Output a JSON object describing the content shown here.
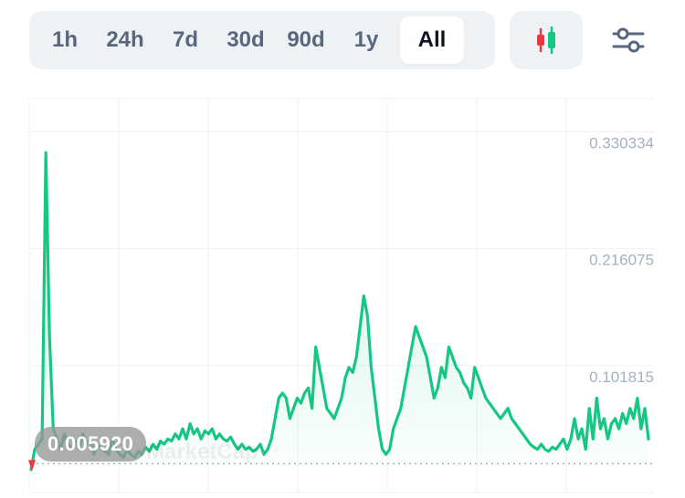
{
  "toolbar": {
    "ranges": [
      "1h",
      "24h",
      "7d",
      "30d",
      "90d",
      "1y",
      "All"
    ],
    "active_range": "All",
    "candle_icon": "candlestick-icon",
    "settings_icon": "sliders-icon"
  },
  "current_price_label": "0.005920",
  "watermark": "MarketCap",
  "colors": {
    "line": "#16c784",
    "fill": "#16c784",
    "baseline_marker": "#ea3943",
    "grid": "#eff2f5",
    "axis_text": "#a6b0c3"
  },
  "chart_data": {
    "type": "area",
    "y_ticks": [
      "0.330334",
      "0.216075",
      "0.101815"
    ],
    "y_tick_values": [
      0.330334,
      0.216075,
      0.101815
    ],
    "ylim": [
      0.0,
      0.345
    ],
    "current_value": 0.00592,
    "grid": true,
    "series": [
      {
        "values": [
          0.0,
          0.02,
          0.025,
          0.03,
          0.31,
          0.13,
          0.04,
          0.03,
          0.02,
          0.035,
          0.025,
          0.02,
          0.028,
          0.02,
          0.035,
          0.025,
          0.03,
          0.015,
          0.025,
          0.02,
          0.018,
          0.015,
          0.03,
          0.02,
          0.015,
          0.012,
          0.02,
          0.015,
          0.012,
          0.018,
          0.015,
          0.022,
          0.018,
          0.025,
          0.02,
          0.028,
          0.025,
          0.03,
          0.028,
          0.035,
          0.03,
          0.04,
          0.03,
          0.045,
          0.035,
          0.04,
          0.03,
          0.038,
          0.035,
          0.04,
          0.03,
          0.035,
          0.03,
          0.028,
          0.032,
          0.025,
          0.02,
          0.025,
          0.02,
          0.022,
          0.018,
          0.02,
          0.025,
          0.015,
          0.02,
          0.03,
          0.05,
          0.07,
          0.075,
          0.07,
          0.05,
          0.06,
          0.07,
          0.065,
          0.075,
          0.08,
          0.06,
          0.12,
          0.1,
          0.08,
          0.06,
          0.055,
          0.05,
          0.06,
          0.07,
          0.09,
          0.1,
          0.095,
          0.11,
          0.14,
          0.17,
          0.15,
          0.1,
          0.07,
          0.04,
          0.02,
          0.015,
          0.02,
          0.04,
          0.05,
          0.06,
          0.08,
          0.1,
          0.12,
          0.14,
          0.13,
          0.12,
          0.11,
          0.09,
          0.07,
          0.08,
          0.1,
          0.09,
          0.12,
          0.11,
          0.1,
          0.095,
          0.085,
          0.08,
          0.07,
          0.1,
          0.09,
          0.08,
          0.07,
          0.065,
          0.06,
          0.055,
          0.05,
          0.055,
          0.06,
          0.05,
          0.045,
          0.04,
          0.035,
          0.03,
          0.025,
          0.022,
          0.02,
          0.025,
          0.02,
          0.018,
          0.022,
          0.02,
          0.025,
          0.03,
          0.02,
          0.03,
          0.05,
          0.03,
          0.04,
          0.02,
          0.06,
          0.03,
          0.07,
          0.04,
          0.05,
          0.03,
          0.045,
          0.05,
          0.04,
          0.055,
          0.045,
          0.06,
          0.05,
          0.07,
          0.04,
          0.06,
          0.03
        ]
      }
    ]
  }
}
